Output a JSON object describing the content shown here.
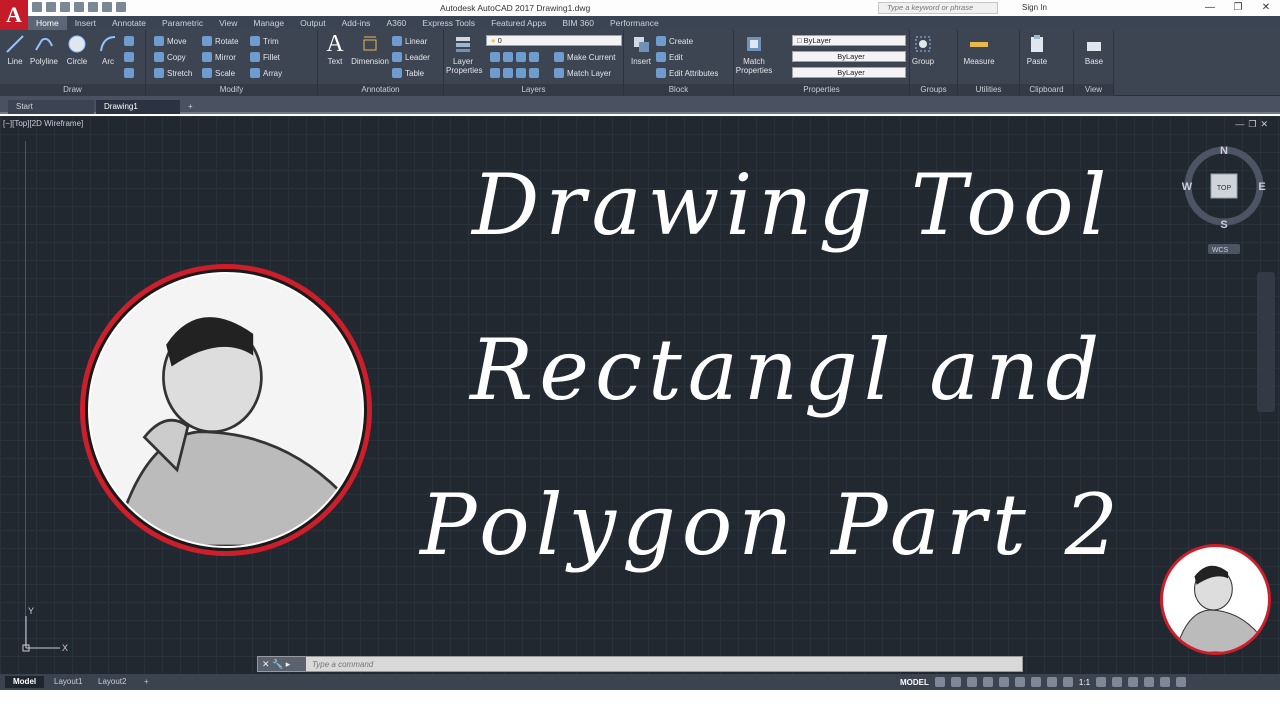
{
  "app": {
    "logo": "A",
    "title": "Autodesk AutoCAD 2017    Drawing1.dwg"
  },
  "search": {
    "placeholder": "Type a keyword or phrase"
  },
  "account": {
    "signin": "Sign In"
  },
  "ribbon_tabs": [
    "Home",
    "Insert",
    "Annotate",
    "Parametric",
    "View",
    "Manage",
    "Output",
    "Add-ins",
    "A360",
    "Express Tools",
    "Featured Apps",
    "BIM 360",
    "Performance"
  ],
  "draw": {
    "line": "Line",
    "polyline": "Polyline",
    "circle": "Circle",
    "arc": "Arc",
    "panel": "Draw"
  },
  "modify": {
    "move": "Move",
    "rotate": "Rotate",
    "trim": "Trim",
    "copy": "Copy",
    "mirror": "Mirror",
    "fillet": "Fillet",
    "stretch": "Stretch",
    "scale": "Scale",
    "array": "Array",
    "panel": "Modify"
  },
  "annotation": {
    "text": "Text",
    "dimension": "Dimension",
    "linear": "Linear",
    "leader": "Leader",
    "table": "Table",
    "panel": "Annotation"
  },
  "layers": {
    "layer_properties": "Layer Properties",
    "current_layer": "0",
    "make_current": "Make Current",
    "match_layer": "Match Layer",
    "panel": "Layers"
  },
  "block": {
    "insert": "Insert",
    "create": "Create",
    "edit": "Edit",
    "edit_attributes": "Edit Attributes",
    "panel": "Block"
  },
  "properties": {
    "match_properties": "Match Properties",
    "color": "ByLayer",
    "linetype": "ByLayer",
    "lineweight": "ByLayer",
    "panel": "Properties"
  },
  "groups": {
    "group": "Group",
    "panel": "Groups"
  },
  "utilities": {
    "measure": "Measure",
    "panel": "Utilities"
  },
  "clipboard": {
    "paste": "Paste",
    "panel": "Clipboard"
  },
  "view": {
    "base": "Base",
    "panel": "View"
  },
  "doc_tabs": {
    "start": "Start",
    "drawing": "Drawing1"
  },
  "viewport": {
    "label": "[−][Top][2D Wireframe]"
  },
  "overlay": {
    "line1": "Drawing Tool",
    "line2": "Rectangl and",
    "line3": "Polygon Part 2"
  },
  "viewcube": {
    "n": "N",
    "s": "S",
    "e": "E",
    "w": "W",
    "top": "TOP",
    "wcs": "WCS"
  },
  "ucs": {
    "x": "X",
    "y": "Y"
  },
  "command": {
    "placeholder": "Type a command"
  },
  "layout_tabs": {
    "model": "Model",
    "layout1": "Layout1",
    "layout2": "Layout2"
  },
  "status": {
    "model": "MODEL",
    "scale": "1:1"
  },
  "colors": {
    "accent": "#c51a28",
    "canvas": "#212830",
    "ribbon": "#3d4553"
  }
}
